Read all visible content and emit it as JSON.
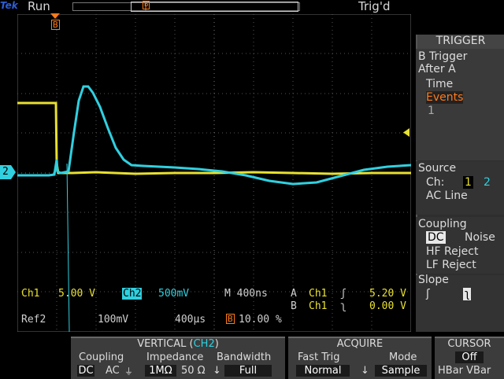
{
  "topbar": {
    "logo": "Tek",
    "status": "Run",
    "trig_status": "Trig'd",
    "marker": "B"
  },
  "screen": {
    "trig_marker": "B",
    "ch2_marker": "2",
    "readout": {
      "ch1_label": "Ch1",
      "ch1_scale": "5.00 V",
      "ch2_label": "Ch2",
      "ch2_scale": "500mV",
      "timebase": "M 400ns",
      "trig_a": "A",
      "trig_a_ch": "Ch1",
      "trig_a_level": "5.20 V",
      "trig_b": "B",
      "trig_b_ch": "Ch1",
      "trig_b_level": "0.00 V",
      "ref_label": "Ref2",
      "ref_scale": "100mV",
      "ref_time": "400µs",
      "pos_marker": "B",
      "pos_percent": "10.00 %"
    }
  },
  "trigger_panel": {
    "title": "TRIGGER",
    "line1": "B Trigger",
    "line2": "After A",
    "opt_time": "Time",
    "opt_events": "Events",
    "events_count": "1",
    "source_label": "Source",
    "source_ch": "Ch:",
    "source_1": "1",
    "source_2": "2",
    "source_ac": "AC Line",
    "coupling_label": "Coupling",
    "coupling_dc": "DC",
    "coupling_noise": "Noise",
    "coupling_hf": "HF Reject",
    "coupling_lf": "LF Reject",
    "slope_label": "Slope"
  },
  "bottom": {
    "vertical": {
      "title_prefix": "VERTICAL (",
      "title_ch": "CH2",
      "title_suffix": ")",
      "coupling_label": "Coupling",
      "coupling_dc": "DC",
      "coupling_ac": "AC",
      "impedance_label": "Impedance",
      "imp_1m": "1MΩ",
      "imp_50": "50 Ω",
      "bandwidth_label": "Bandwidth",
      "bandwidth_value": "Full"
    },
    "acquire": {
      "title": "ACQUIRE",
      "fast_trig_label": "Fast Trig",
      "fast_trig_value": "Normal",
      "mode_label": "Mode",
      "mode_value": "Sample"
    },
    "cursor": {
      "title": "CURSOR",
      "value": "Off",
      "options": "HBar VBar"
    }
  },
  "colors": {
    "ch1": "#e8e030",
    "ch2": "#30d0e0",
    "accent": "#ff7a1a"
  }
}
